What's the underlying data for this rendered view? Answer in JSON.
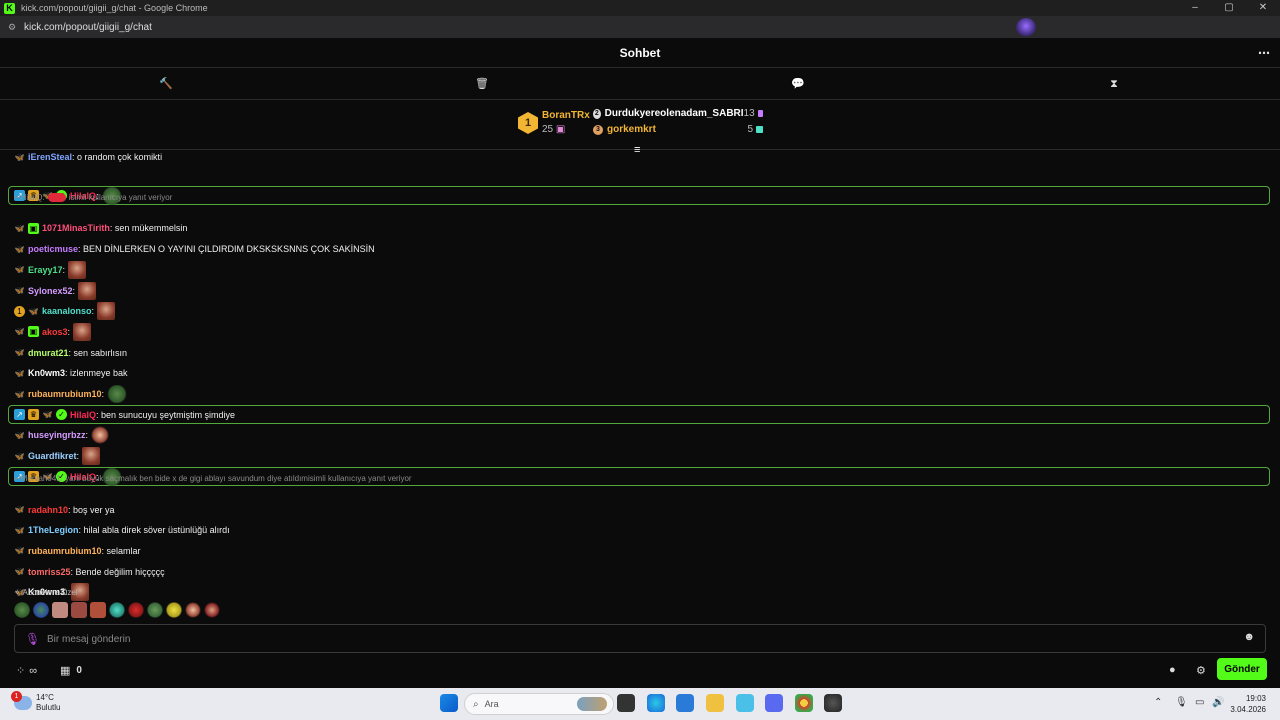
{
  "window": {
    "title": "kick.com/popout/giigii_g/chat - Google Chrome",
    "url": "kick.com/popout/giigii_g/chat",
    "controls": [
      "–",
      "▢",
      "✕"
    ]
  },
  "chat": {
    "header_title": "Sohbet",
    "more_icon": "⋯",
    "tools": [
      {
        "name": "hammer-icon",
        "glyph": "🔨"
      },
      {
        "name": "trash-icon",
        "glyph": "🗑"
      },
      {
        "name": "speech-bubble-icon",
        "glyph": "💬"
      },
      {
        "name": "hourglass-icon",
        "glyph": "⧗"
      }
    ]
  },
  "leaderboard": {
    "first": {
      "rank": "1",
      "name": "BoranTRx",
      "count": "25"
    },
    "second": {
      "name": "Durdukyereolenadam_SABRI",
      "count": "13"
    },
    "third": {
      "name": "gorkemkrt",
      "count": "5"
    }
  },
  "colors": {
    "accent": "#53fc18",
    "gold": "#f2b633",
    "hilal": "#ff2a55"
  },
  "messages": [
    {
      "user": "iErenSteal",
      "color": "#7fa6ff",
      "text": ": o random çok komikti",
      "badges": [
        "butterfly"
      ],
      "emotes": []
    },
    {
      "user": "HilalQ",
      "color": "#ff2a55",
      "text": ":",
      "badges": [
        "sub",
        "crown",
        "butterfly",
        "verified"
      ],
      "emotes": [
        "frog"
      ],
      "highlight": true
    },
    {
      "reply": "HilalQ:",
      "reply_suffix": "isimli kullanıcıya yanıt veriyor"
    },
    {
      "user": "1071MinasTirith",
      "color": "#ff4f7a",
      "text": ": sen mükemmelsin",
      "badges": [
        "butterfly",
        "gift"
      ],
      "emotes": []
    },
    {
      "user": "poeticmuse",
      "color": "#c57cff",
      "text": ": BEN DİNLERKEN O YAYINI ÇILDIRDIM DKSKSKSNNS ÇOK SAKİNSİN",
      "badges": [
        "butterfly"
      ],
      "emotes": []
    },
    {
      "user": "Erayy17",
      "color": "#4fe08a",
      "text": ":",
      "badges": [
        "butterfly-o"
      ],
      "emotes": [
        "face"
      ]
    },
    {
      "user": "Sylonex52",
      "color": "#d69cff",
      "text": ":",
      "badges": [
        "butterfly"
      ],
      "emotes": [
        "face"
      ]
    },
    {
      "user": "kaanalonso",
      "color": "#4fe0c8",
      "text": ":",
      "badges": [
        "coin",
        "butterfly"
      ],
      "emotes": [
        "face"
      ]
    },
    {
      "user": "akos3",
      "color": "#ff3a3a",
      "text": ":",
      "badges": [
        "butterfly",
        "gift"
      ],
      "emotes": [
        "face"
      ]
    },
    {
      "user": "dmurat21",
      "color": "#b6ff6a",
      "text": ": sen sabırlısın",
      "badges": [
        "butterfly-o"
      ],
      "emotes": []
    },
    {
      "user": "Kn0wm3",
      "color": "#ffffff",
      "text": ": izlenmeye bak",
      "badges": [
        "butterfly"
      ],
      "emotes": []
    },
    {
      "user": "rubaumrubium10",
      "color": "#ffb35a",
      "text": ":",
      "badges": [
        "butterfly"
      ],
      "emotes": [
        "frog"
      ]
    },
    {
      "user": "HilalQ",
      "color": "#ff2a55",
      "text": ": ben sunucuyu şeytmiştim şimdiye",
      "badges": [
        "sub",
        "crown",
        "butterfly",
        "verified"
      ],
      "emotes": [],
      "highlight": true
    },
    {
      "user": "huseyingrbzz",
      "color": "#d69cff",
      "text": ":",
      "badges": [
        "butterfly"
      ],
      "emotes": [
        "girl"
      ]
    },
    {
      "user": "Guardfikret",
      "color": "#9ad0ff",
      "text": ":",
      "badges": [
        "butterfly"
      ],
      "emotes": [
        "face"
      ]
    },
    {
      "user": "HilalQ",
      "color": "#ff2a55",
      "text": ":",
      "badges": [
        "sub",
        "crown",
        "butterfly",
        "verified"
      ],
      "emotes": [
        "frog"
      ],
      "highlight": true
    },
    {
      "reply": "Mervan041: yani büyük saçmalık ben bide x de gigi ablayı savundum diye atıldım",
      "reply_suffix": "isimli kullanıcıya yanıt veriyor"
    },
    {
      "user": "radahn10",
      "color": "#ff3a3a",
      "text": ": boş ver ya",
      "badges": [
        "butterfly"
      ],
      "emotes": []
    },
    {
      "user": "1TheLegion",
      "color": "#7fd0ff",
      "text": ": hilal abla direk söver üstünlüğü alırdı",
      "badges": [
        "butterfly"
      ],
      "emotes": []
    },
    {
      "user": "rubaumrubium10",
      "color": "#ffb35a",
      "text": ": selamlar",
      "badges": [
        "butterfly"
      ],
      "emotes": []
    },
    {
      "user": "tomriss25",
      "color": "#ff6a6a",
      "text": ": Bende değilim hiççççç",
      "badges": [
        "butterfly-o"
      ],
      "emotes": []
    },
    {
      "user": "Kn0wm3",
      "color": "#ffffff",
      "text": ":",
      "badges": [
        "butterfly"
      ],
      "emotes": [
        "face"
      ]
    }
  ],
  "subs_only_label": "Abonelere Özel",
  "input": {
    "placeholder": "Bir mesaj gönderin"
  },
  "bottom": {
    "points_symbol": "∞",
    "store_count": "0",
    "send_label": "Gönder"
  },
  "taskbar": {
    "temperature": "14°C",
    "weather": "Bulutlu",
    "weather_alert": "1",
    "search_placeholder": "Ara",
    "time": "19:03",
    "date": "3.04.2026"
  }
}
